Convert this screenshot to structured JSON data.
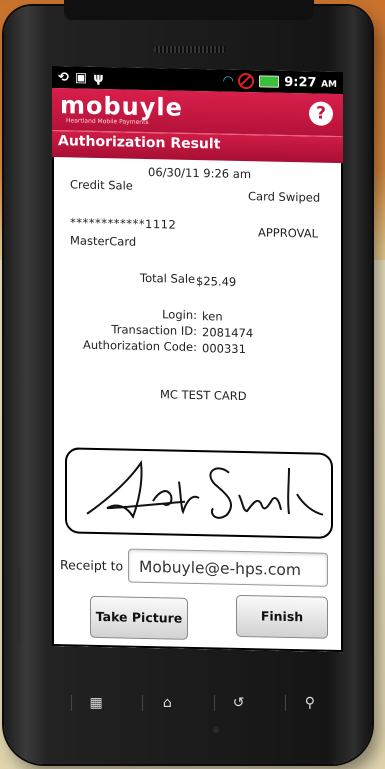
{
  "status_bar": {
    "time": "9:27",
    "ampm": "AM"
  },
  "brand": {
    "logo": "mobuyle",
    "tagline": "Heartland Mobile Payments",
    "help_icon": "?"
  },
  "screen_title": "Authorization Result",
  "receipt": {
    "datetime": "06/30/11 9:26 am",
    "transaction_type": "Credit Sale",
    "entry_mode": "Card Swiped",
    "card_number": "************1112",
    "status": "APPROVAL",
    "card_brand": "MasterCard",
    "total_label": "Total Sale",
    "total_value": "$25.49",
    "login_label": "Login:",
    "login_value": "ken",
    "txn_label": "Transaction ID:",
    "txn_value": "2081474",
    "auth_label": "Authorization Code:",
    "auth_value": "000331",
    "card_name": "MC TEST CARD"
  },
  "receipt_to": {
    "label": "Receipt to",
    "value": "Mobuyle@e-hps.com"
  },
  "buttons": {
    "take_picture": "Take Picture",
    "finish": "Finish"
  },
  "nav_icons": [
    "grid-icon",
    "home-icon",
    "back-icon",
    "search-icon"
  ]
}
